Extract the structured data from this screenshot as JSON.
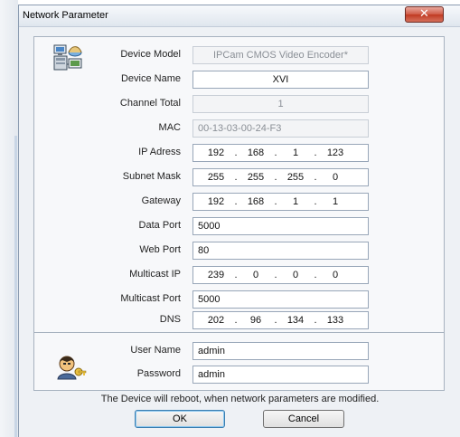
{
  "window": {
    "title": "Network Parameter",
    "close_glyph": "✕"
  },
  "icons": {
    "device": "network-devices-icon",
    "user": "user-key-icon",
    "close": "close-icon"
  },
  "fields": {
    "device_model": {
      "label": "Device Model",
      "value": "IPCam CMOS Video Encoder*"
    },
    "device_name": {
      "label": "Device Name",
      "value": "XVI"
    },
    "channel_total": {
      "label": "Channel Total",
      "value": "1"
    },
    "mac": {
      "label": "MAC",
      "value": "00-13-03-00-24-F3"
    },
    "ip_address": {
      "label": "IP Adress",
      "octets": [
        "192",
        "168",
        "1",
        "123"
      ]
    },
    "subnet_mask": {
      "label": "Subnet Mask",
      "octets": [
        "255",
        "255",
        "255",
        "0"
      ]
    },
    "gateway": {
      "label": "Gateway",
      "octets": [
        "192",
        "168",
        "1",
        "1"
      ]
    },
    "data_port": {
      "label": "Data Port",
      "value": "5000"
    },
    "web_port": {
      "label": "Web Port",
      "value": "80"
    },
    "multicast_ip": {
      "label": "Multicast IP",
      "octets": [
        "239",
        "0",
        "0",
        "0"
      ]
    },
    "multicast_port": {
      "label": "Multicast  Port",
      "value": "5000"
    },
    "dns": {
      "label": "DNS",
      "octets": [
        "202",
        "96",
        "134",
        "133"
      ]
    }
  },
  "account": {
    "user_name": {
      "label": "User Name",
      "value": "admin"
    },
    "password": {
      "label": "Password",
      "value": "admin"
    }
  },
  "note": "The Device will reboot, when network parameters are modified.",
  "buttons": {
    "ok": "OK",
    "cancel": "Cancel"
  },
  "colors": {
    "close_button": "#c8432b",
    "ok_focus": "#3c7fb1"
  }
}
